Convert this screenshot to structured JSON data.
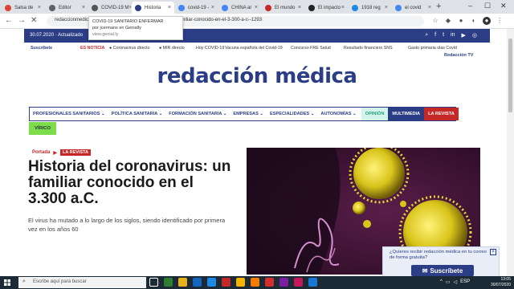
{
  "browser": {
    "tabs": [
      {
        "label": "Salsa de",
        "color": "#db4437"
      },
      {
        "label": "Editor",
        "color": "#5f6368"
      },
      {
        "label": "COVID-19 M",
        "color": "#555"
      },
      {
        "label": "Historia",
        "color": "#2a3d85",
        "active": true
      },
      {
        "label": "covid-19 -",
        "color": "#4285f4"
      },
      {
        "label": "CHINA ar",
        "color": "#4285f4"
      },
      {
        "label": "El mundo",
        "color": "#c62828"
      },
      {
        "label": "El impacto",
        "color": "#222"
      },
      {
        "label": "1918 reg",
        "color": "#1e88e5"
      },
      {
        "label": "el covid",
        "color": "#4285f4"
      }
    ],
    "url": "redaccionmedica.com/revista/historia-del-coronavirus-un-familiar-conocido-en-el-3-300-a-c--1293",
    "tooltip": {
      "title": "COVID-19 SANITARIO ENFERMAR",
      "line2": "por jcermans en Genially",
      "line3": "view.genial.ly"
    }
  },
  "site": {
    "date": "30.07.2020 · Actualizado",
    "secondary": [
      {
        "label": "Suscríbete",
        "style": "blue"
      },
      {
        "label": "ES NOTICIA",
        "style": "red"
      },
      {
        "label": "● Coronavirus directo",
        "style": "plain"
      },
      {
        "label": "● MIR directo",
        "style": "plain"
      },
      {
        "label": "Hoy COVID-19",
        "style": "plain"
      },
      {
        "label": "Vacuna española del Covid-19",
        "style": "plain"
      },
      {
        "label": "Concurso FRE Salud",
        "style": "plain"
      },
      {
        "label": "Resultado financiero SNS",
        "style": "plain"
      },
      {
        "label": "Gasto primaria olas Covid",
        "style": "plain"
      }
    ],
    "tv_link": "Redacción TV",
    "logo": "redacción médica",
    "nav": [
      "PROFESIONALES SANITARIOS ⌄",
      "POLÍTICA SANITARIA ⌄",
      "FORMACIÓN SANITARIA ⌄",
      "EMPRESAS ⌄",
      "ESPECIALIDADES ⌄",
      "AUTONOMÍAS ⌄"
    ],
    "nav_opinion": "OPINIÓN",
    "nav_multimedia": "MULTIMEDIA",
    "nav_revista": "LA REVISTA",
    "virico": "VÍRICO"
  },
  "article": {
    "breadcrumb_home": "Portada",
    "breadcrumb_sep": "▶",
    "breadcrumb_section": "LA REVISTA",
    "title": "Historia del coronavirus: un familiar conocido en el 3.300 a.C.",
    "lead": "El virus ha mutado a lo largo de los siglos, siendo identificado por primera vez en los años 60"
  },
  "subscribe": {
    "text": "¿Quieres recibir redacción médica en tu correo de forma gratuita?",
    "close": "×",
    "button": "Suscríbete"
  },
  "taskbar": {
    "search_placeholder": "Escribe aquí para buscar",
    "time": "13:05",
    "date": "30/07/2020",
    "lang": "ESP"
  }
}
